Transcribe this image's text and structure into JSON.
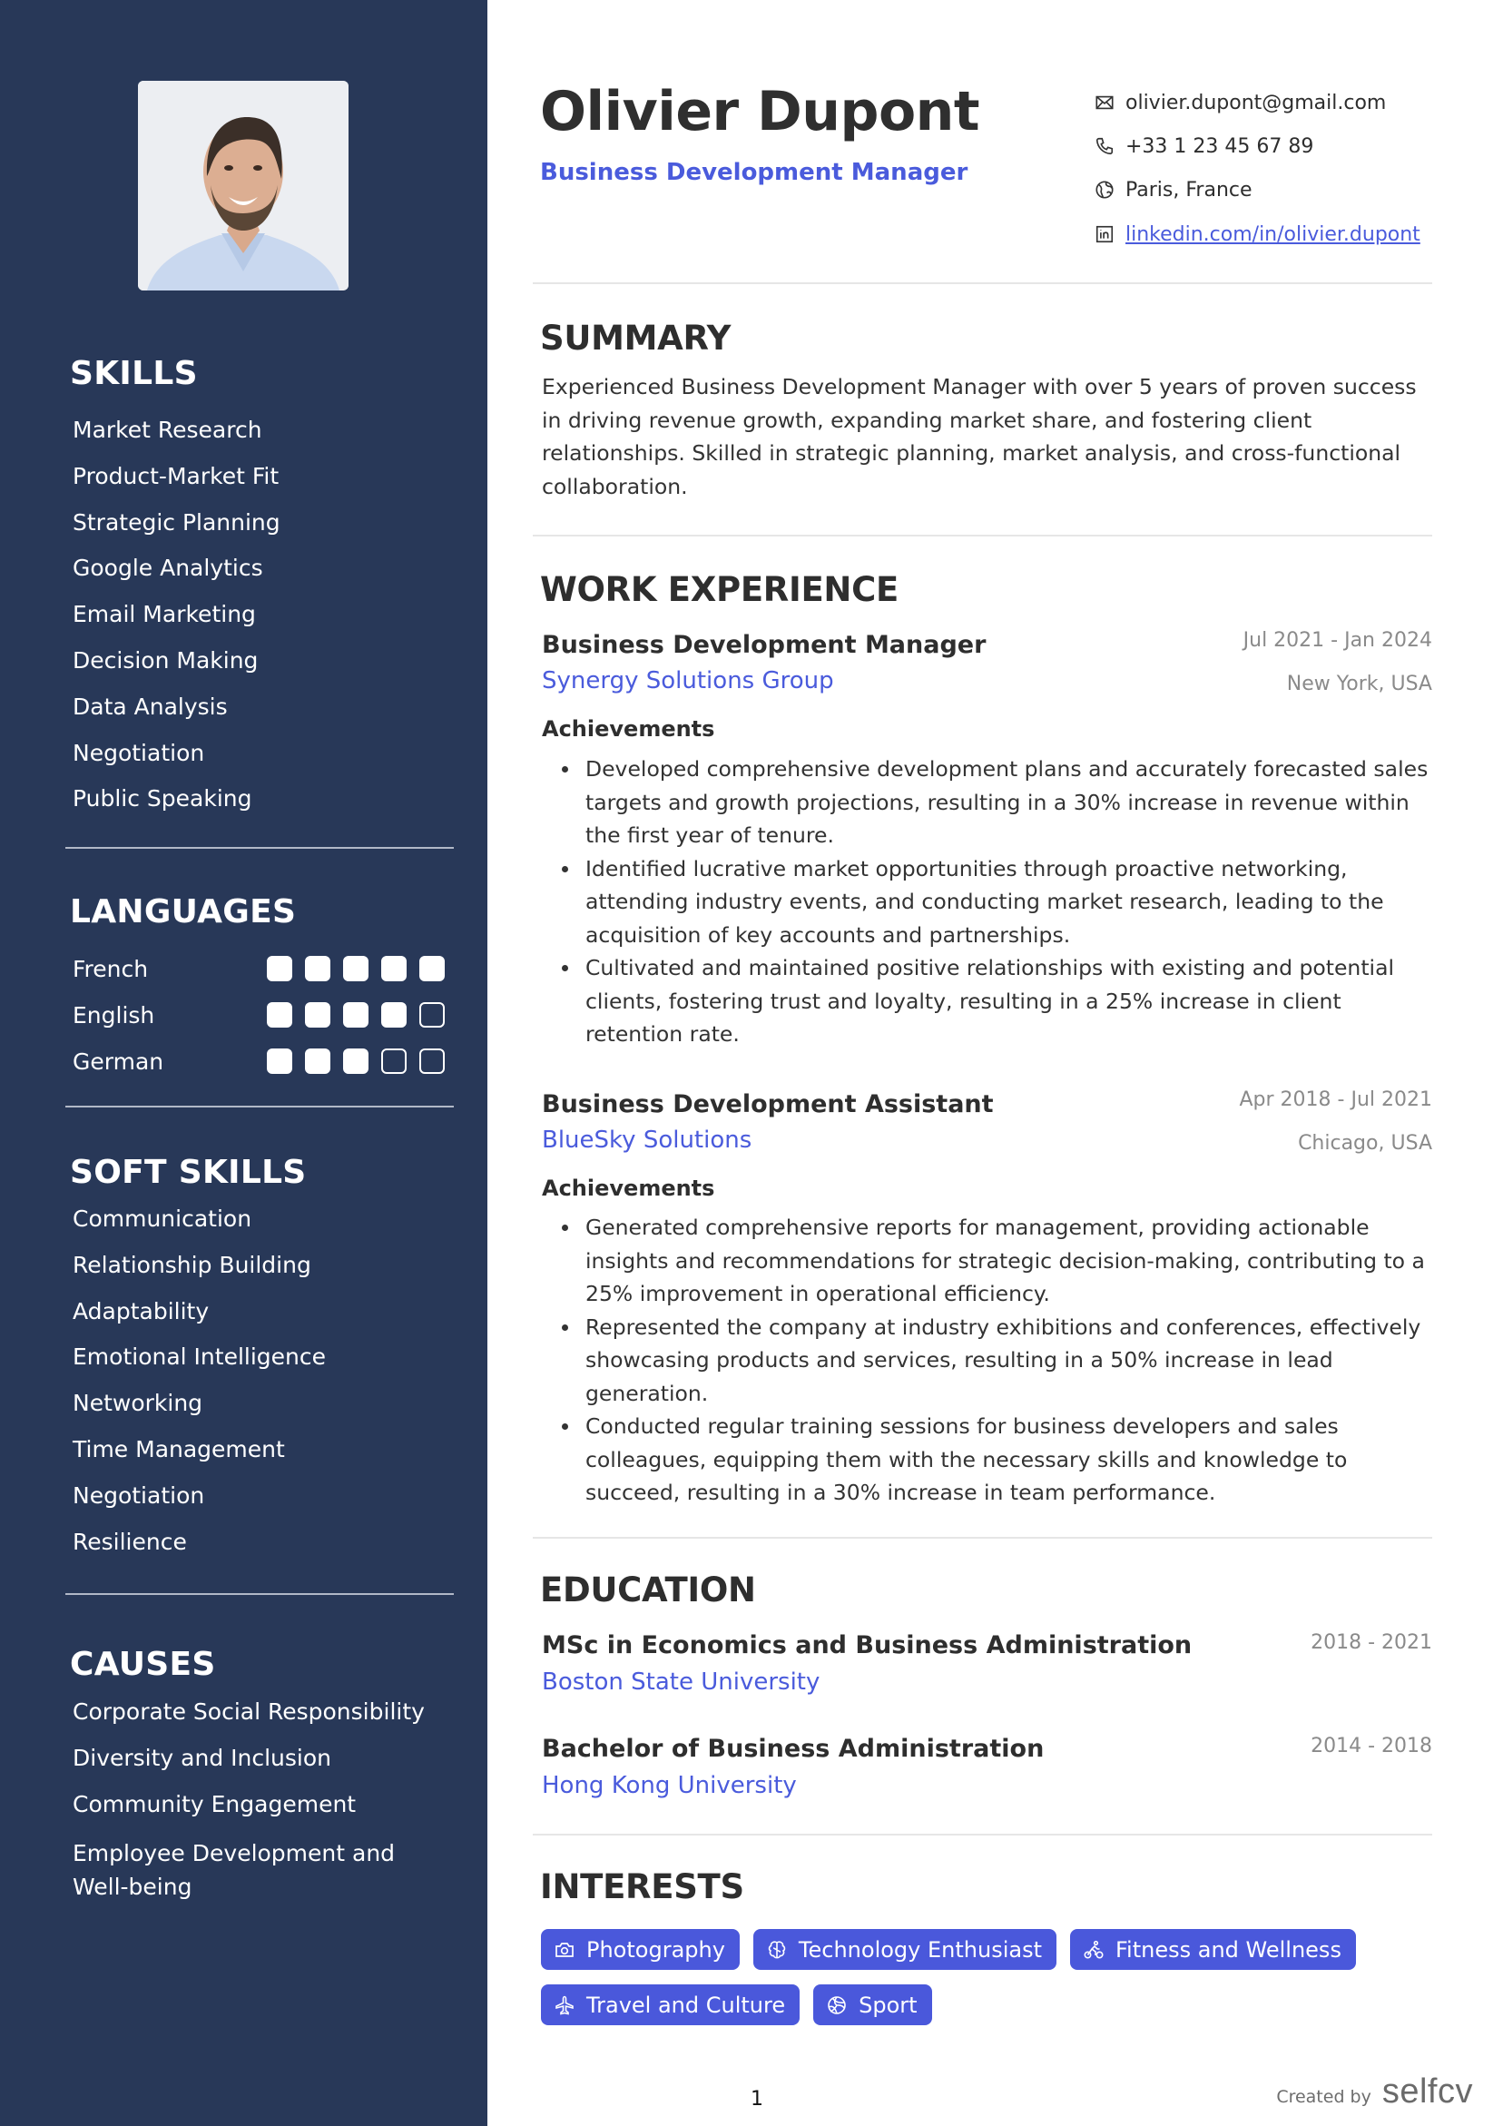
{
  "profile": {
    "name": "Olivier Dupont",
    "title": "Business Development Manager",
    "photo_alt": "Portrait photo of Olivier Dupont"
  },
  "contact": {
    "email": {
      "icon": "mail-icon",
      "text": "olivier.dupont@gmail.com"
    },
    "phone": {
      "icon": "phone-icon",
      "text": "+33 1 23 45 67 89"
    },
    "location": {
      "icon": "globe-icon",
      "text": "Paris, France"
    },
    "linkedin": {
      "icon": "linkedin-icon",
      "text": "linkedin.com/in/olivier.dupont"
    }
  },
  "sidebar": {
    "skills": {
      "heading": "SKILLS",
      "items": [
        "Market Research",
        "Product-Market Fit",
        "Strategic Planning",
        "Google Analytics",
        "Email Marketing",
        "Decision Making",
        "Data Analysis",
        "Negotiation",
        "Public Speaking"
      ]
    },
    "languages": {
      "heading": "LANGUAGES",
      "max_level": 5,
      "items": [
        {
          "name": "French",
          "level": 5
        },
        {
          "name": "English",
          "level": 4
        },
        {
          "name": "German",
          "level": 3
        }
      ]
    },
    "soft_skills": {
      "heading": "SOFT SKILLS",
      "items": [
        "Communication",
        "Relationship Building",
        "Adaptability",
        "Emotional Intelligence",
        "Networking",
        "Time Management",
        "Negotiation",
        "Resilience"
      ]
    },
    "causes": {
      "heading": "CAUSES",
      "items": [
        "Corporate Social Responsibility",
        "Diversity and Inclusion",
        "Community Engagement",
        "Employee Development and Well-being"
      ]
    }
  },
  "summary": {
    "heading": "SUMMARY",
    "text": "Experienced Business Development Manager with over 5 years of proven success in driving revenue growth, expanding market share, and fostering client relationships. Skilled in strategic planning, market analysis, and cross-functional collaboration."
  },
  "experience": {
    "heading": "WORK EXPERIENCE",
    "jobs": [
      {
        "role": "Business Development Manager",
        "company": "Synergy Solutions Group",
        "dates": "Jul 2021 - Jan 2024",
        "location": "New York, USA",
        "subheading": "Achievements",
        "bullets": [
          "Developed comprehensive development plans and accurately forecasted sales targets and growth projections, resulting in a 30% increase in revenue within the first year of tenure.",
          "Identified lucrative market opportunities through proactive networking, attending industry events, and conducting market research, leading to the acquisition of key accounts and partnerships.",
          "Cultivated and maintained positive relationships with existing and potential clients, fostering trust and loyalty, resulting in a 25% increase in client retention rate."
        ]
      },
      {
        "role": "Business Development Assistant",
        "company": "BlueSky Solutions",
        "dates": "Apr 2018 - Jul 2021",
        "location": "Chicago, USA",
        "subheading": "Achievements",
        "bullets": [
          "Generated comprehensive reports for management, providing actionable insights and recommendations for strategic decision-making, contributing to a 25% improvement in operational efficiency.",
          "Represented the company at industry exhibitions and conferences, effectively showcasing products and services, resulting in a 50% increase in lead generation.",
          "Conducted regular training sessions for business developers and sales colleagues, equipping them with the necessary skills and knowledge to succeed, resulting in a 30% increase in team performance."
        ]
      }
    ]
  },
  "education": {
    "heading": "EDUCATION",
    "items": [
      {
        "degree": "MSc in Economics and Business Administration",
        "school": "Boston State University",
        "dates": "2018 - 2021"
      },
      {
        "degree": "Bachelor of Business Administration",
        "school": "Hong Kong University",
        "dates": "2014 - 2018"
      }
    ]
  },
  "interests": {
    "heading": "INTERESTS",
    "items": [
      {
        "label": "Photography",
        "icon": "camera-icon"
      },
      {
        "label": "Technology Enthusiast",
        "icon": "brain-icon"
      },
      {
        "label": "Fitness and Wellness",
        "icon": "cyclist-icon"
      },
      {
        "label": "Travel and Culture",
        "icon": "airplane-icon"
      },
      {
        "label": "Sport",
        "icon": "volleyball-icon"
      }
    ]
  },
  "footer": {
    "page_number": "1",
    "created_by": "Created by",
    "brand": "selfcv"
  },
  "colors": {
    "sidebar_bg": "#283858",
    "accent": "#4a5bdc",
    "chip_bg": "#4a58db",
    "text": "#2e2e2e",
    "muted": "#8a8a8a"
  }
}
